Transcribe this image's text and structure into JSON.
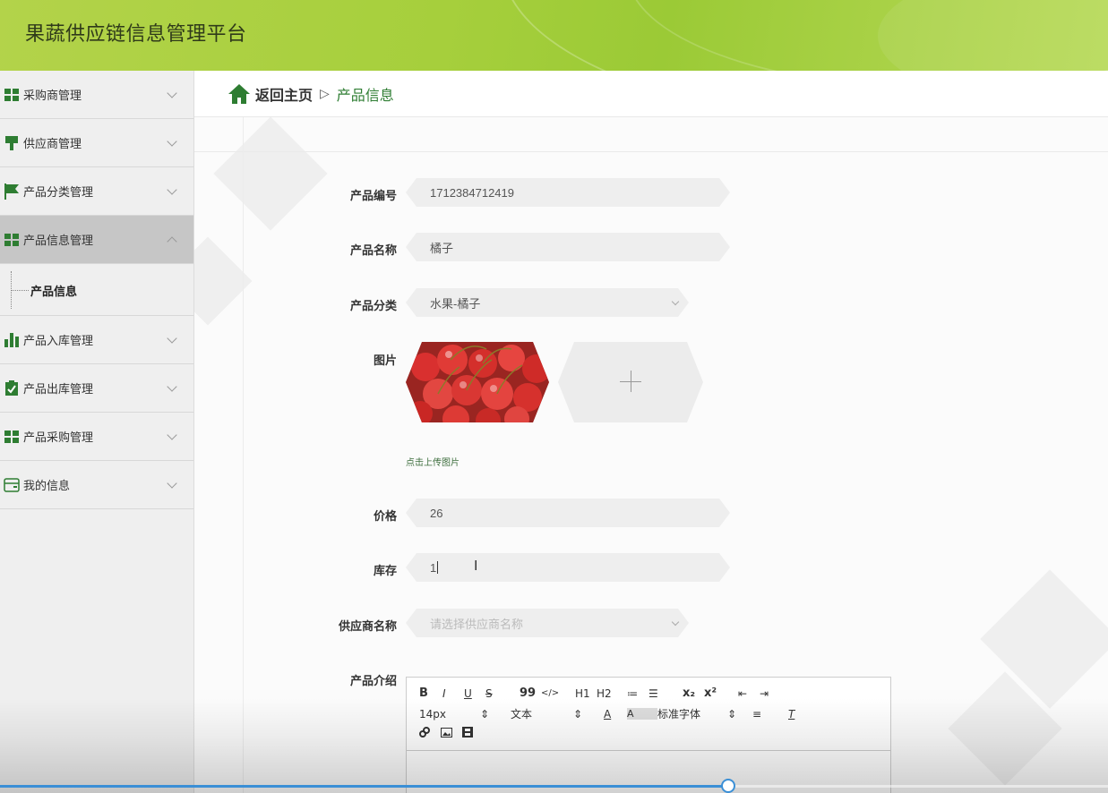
{
  "header": {
    "title": "果蔬供应链信息管理平台"
  },
  "sidebar": {
    "items": [
      {
        "label": "采购商管理",
        "icon": "grid-icon"
      },
      {
        "label": "供应商管理",
        "icon": "hammer-icon"
      },
      {
        "label": "产品分类管理",
        "icon": "flag-icon"
      },
      {
        "label": "产品信息管理",
        "icon": "grid-icon",
        "active": true
      },
      {
        "label": "产品入库管理",
        "icon": "bar-chart-icon"
      },
      {
        "label": "产品出库管理",
        "icon": "clipboard-check-icon"
      },
      {
        "label": "产品采购管理",
        "icon": "grid-icon"
      },
      {
        "label": "我的信息",
        "icon": "wallet-icon"
      }
    ],
    "submenu": {
      "label": "产品信息"
    }
  },
  "breadcrumb": {
    "home": "返回主页",
    "separator": "▷",
    "current": "产品信息"
  },
  "form": {
    "code_label": "产品编号",
    "code_value": "1712384712419",
    "name_label": "产品名称",
    "name_value": "橘子",
    "category_label": "产品分类",
    "category_value": "水果-橘子",
    "image_label": "图片",
    "upload_hint": "点击上传图片",
    "price_label": "价格",
    "price_value": "26",
    "stock_label": "库存",
    "stock_value": "1",
    "supplier_label": "供应商名称",
    "supplier_placeholder": "请选择供应商名称",
    "intro_label": "产品介绍"
  },
  "editor": {
    "row1": [
      "B",
      "I",
      "U",
      "S",
      "99",
      "</>",
      "H1",
      "H2",
      "≔",
      "☰",
      "x₂",
      "x²",
      "⇤",
      "⇥"
    ],
    "font_size": "14px",
    "text_type": "文本",
    "font_family": "标准字体"
  },
  "video": {
    "progress": 0.657
  },
  "colors": {
    "accent": "#2e7d32",
    "header": "#a6cf3c",
    "progress": "#3b8fd6"
  }
}
